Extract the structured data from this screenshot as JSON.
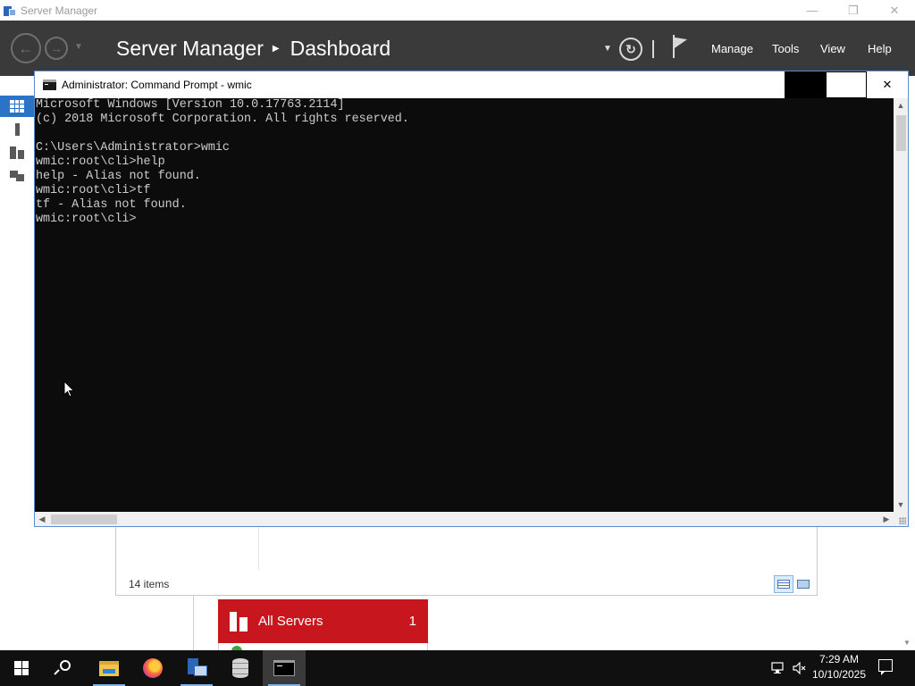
{
  "server_manager": {
    "window_title": "Server Manager",
    "breadcrumb": {
      "app": "Server Manager",
      "page": "Dashboard"
    },
    "menu": {
      "manage": "Manage",
      "tools": "Tools",
      "view": "View",
      "help": "Help"
    },
    "left_nav": [
      {
        "icon": "dashboard-grid-icon",
        "active": true
      },
      {
        "icon": "local-server-icon",
        "active": false
      },
      {
        "icon": "all-servers-icon",
        "active": false
      },
      {
        "icon": "file-storage-icon",
        "active": false
      }
    ],
    "panel": {
      "items_count": "14 items"
    },
    "tile": {
      "label": "All Servers",
      "count": "1",
      "color": "#c8161e"
    },
    "accent": "#2b73c6"
  },
  "cmd": {
    "window_title": "Administrator: Command Prompt - wmic",
    "console_lines": [
      "Microsoft Windows [Version 10.0.17763.2114]",
      "(c) 2018 Microsoft Corporation. All rights reserved.",
      "",
      "C:\\Users\\Administrator>wmic",
      "wmic:root\\cli>help",
      "help - Alias not found.",
      "wmic:root\\cli>tf",
      "tf - Alias not found.",
      "wmic:root\\cli>"
    ]
  },
  "taskbar": {
    "apps": [
      "start-icon",
      "search-icon",
      "file-explorer-icon",
      "firefox-icon",
      "server-manager-icon",
      "database-icon",
      "command-prompt-icon"
    ],
    "active_app": "command-prompt-icon",
    "time": "7:29 AM",
    "date": "10/10/2025"
  }
}
